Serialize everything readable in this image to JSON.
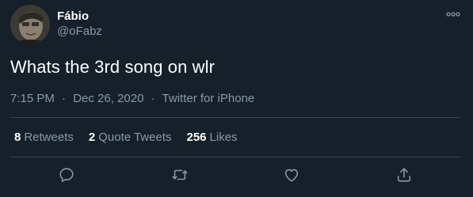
{
  "author": {
    "name": "Fábio",
    "handle": "@oFabz"
  },
  "tweet": {
    "text": "Whats the 3rd song on wlr",
    "time": "7:15 PM",
    "separator": "·",
    "date": "Dec 26, 2020",
    "source": "Twitter for iPhone"
  },
  "stats": {
    "retweets_count": "8",
    "retweets_label": "Retweets",
    "quotes_count": "2",
    "quotes_label": "Quote Tweets",
    "likes_count": "256",
    "likes_label": "Likes"
  },
  "icons": {
    "more": "more-horizontal-icon",
    "reply": "reply-icon",
    "retweet": "retweet-icon",
    "like": "like-icon",
    "share": "share-icon"
  },
  "colors": {
    "background": "#15202b",
    "primary_text": "#ffffff",
    "secondary_text": "#8899a6",
    "divider": "#38444d"
  }
}
